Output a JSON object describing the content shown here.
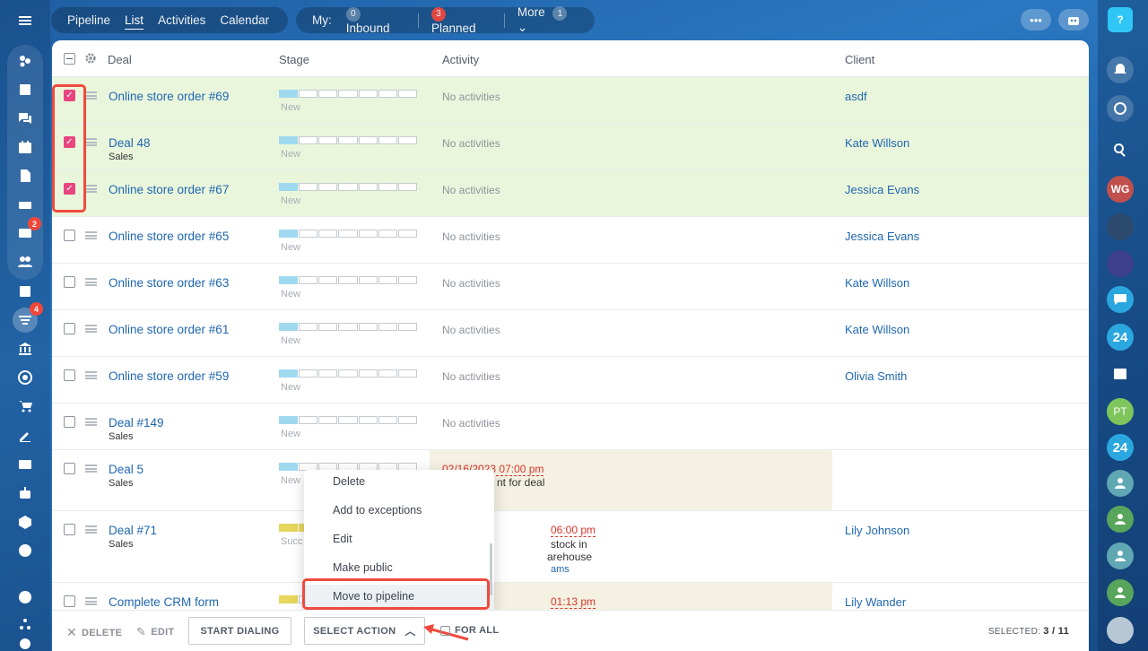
{
  "topbar": {
    "tabs": [
      {
        "label": "Pipeline",
        "active": false
      },
      {
        "label": "List",
        "active": true
      },
      {
        "label": "Activities",
        "active": false
      },
      {
        "label": "Calendar",
        "active": false
      }
    ],
    "filters": {
      "my_label": "My:",
      "inbound_count": "0",
      "inbound_label": "Inbound",
      "planned_count": "3",
      "planned_label": "Planned",
      "more_label": "More",
      "more_count": "1"
    }
  },
  "left_rail": {
    "mail_badge": "2",
    "crm_badge": "4"
  },
  "right_rail": {
    "avatars": [
      "WG",
      "PT"
    ],
    "bitrix_label": "24"
  },
  "table": {
    "columns": {
      "deal": "Deal",
      "stage": "Stage",
      "activity": "Activity",
      "client": "Client"
    },
    "rows": [
      {
        "title": "Online store order #69",
        "sub": "",
        "stage": "New",
        "activity": "No activities",
        "client": "asdf",
        "checked": true
      },
      {
        "title": "Deal 48",
        "sub": "Sales",
        "stage": "New",
        "activity": "No activities",
        "client": "Kate Willson",
        "checked": true
      },
      {
        "title": "Online store order #67",
        "sub": "",
        "stage": "New",
        "activity": "No activities",
        "client": "Jessica Evans",
        "checked": true
      },
      {
        "title": "Online store order #65",
        "sub": "",
        "stage": "New",
        "activity": "No activities",
        "client": "Jessica Evans",
        "checked": false
      },
      {
        "title": "Online store order #63",
        "sub": "",
        "stage": "New",
        "activity": "No activities",
        "client": "Kate Willson",
        "checked": false
      },
      {
        "title": "Online store order #61",
        "sub": "",
        "stage": "New",
        "activity": "No activities",
        "client": "Kate Willson",
        "checked": false
      },
      {
        "title": "Online store order #59",
        "sub": "",
        "stage": "New",
        "activity": "No activities",
        "client": "Olivia Smith",
        "checked": false
      },
      {
        "title": "Deal #149",
        "sub": "Sales",
        "stage": "New",
        "activity": "No activities",
        "client": "",
        "checked": false
      },
      {
        "title": "Deal 5",
        "sub": "Sales",
        "stage": "New",
        "activity_date": "02/16/2023 07:00 pm",
        "activity_text": "nt for deal",
        "client": "",
        "checked": false
      },
      {
        "title": "Deal #71",
        "sub": "Sales",
        "stage": "Succ",
        "activity_date": "06:00 pm",
        "activity_text_1": "stock in",
        "activity_text_2": "arehouse",
        "activity_link": "ams",
        "client": "Lily Johnson",
        "checked": false
      },
      {
        "title": "Complete CRM form",
        "sub": "",
        "stage": "",
        "activity_date": "01:13 pm",
        "client": "Lily Wander",
        "checked": false
      }
    ]
  },
  "action_menu": {
    "items": [
      "Delete",
      "Add to exceptions",
      "Edit",
      "Make public",
      "Move to pipeline"
    ]
  },
  "footer": {
    "delete_label": "DELETE",
    "edit_label": "EDIT",
    "start_dialing_label": "START DIALING",
    "select_action_label": "SELECT ACTION",
    "for_all_label": "FOR ALL",
    "selected_label": "SELECTED:",
    "selected_value": "3 / 11"
  },
  "colors": {
    "accent_link": "#2067b0",
    "checkbox_on": "#e8457f",
    "selected_row": "#eaf6dc",
    "annotation_red": "#f04a3e",
    "overdue_red": "#d9342a"
  },
  "icons": [
    "hamburger-icon",
    "bell-icon",
    "search-icon",
    "help-icon",
    "gear-icon",
    "chevron-down-icon",
    "chevron-up-icon",
    "more-dots-icon",
    "bot-icon"
  ]
}
